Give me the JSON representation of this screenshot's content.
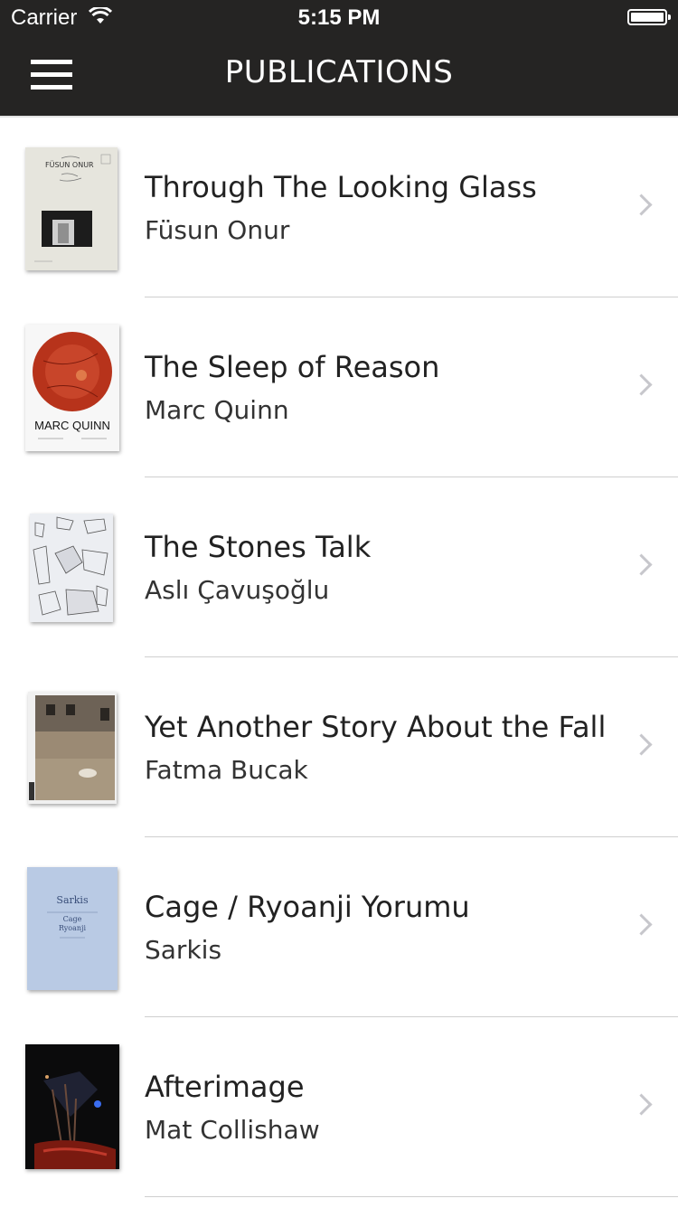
{
  "status_bar": {
    "carrier": "Carrier",
    "time": "5:15 PM"
  },
  "nav": {
    "title": "PUBLICATIONS",
    "menu_icon": "hamburger-menu-icon"
  },
  "publications": [
    {
      "title": "Through The Looking Glass",
      "author": "Füsun Onur",
      "cover_text": "FÜSUN ONUR"
    },
    {
      "title": "The Sleep of Reason",
      "author": "Marc Quinn",
      "cover_text": "MARC QUINN"
    },
    {
      "title": "The Stones Talk",
      "author": "Aslı Çavuşoğlu",
      "cover_text": ""
    },
    {
      "title": "Yet Another Story About the Fall",
      "author": "Fatma Bucak",
      "cover_text": ""
    },
    {
      "title": "Cage / Ryoanji Yorumu",
      "author": "Sarkis",
      "cover_text": "Sarkis",
      "cover_text_2": "Cage",
      "cover_text_3": "Ryoanji"
    },
    {
      "title": "Afterimage",
      "author": "Mat Collishaw",
      "cover_text": ""
    }
  ],
  "colors": {
    "nav_background": "#252423",
    "separator": "#cfcfcf",
    "chevron": "#c7c7cc"
  }
}
